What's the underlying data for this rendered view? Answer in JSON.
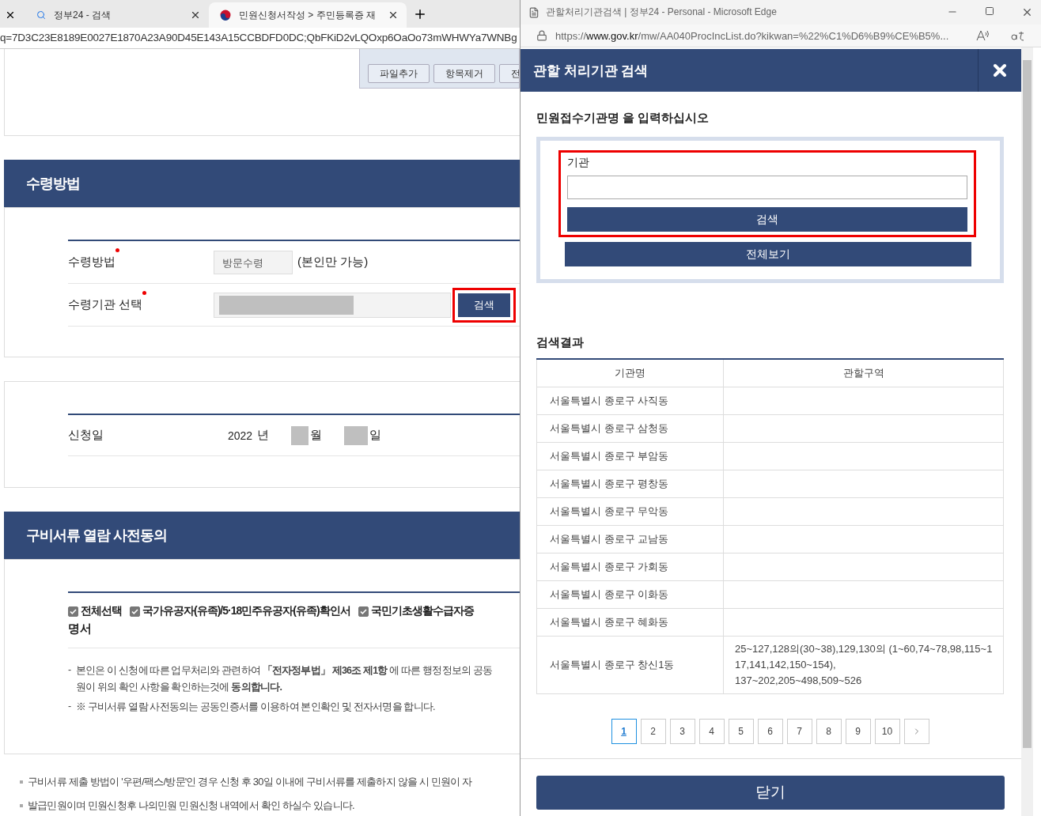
{
  "browser": {
    "tabs": [
      {
        "label": "정부24 - 검색",
        "selected": false
      },
      {
        "label": "민원신청서작성 > 주민등록증 재",
        "selected": true
      }
    ],
    "address": "q=7D3C23E8189E0027E1870A23A90D45E143A15CCBDFD0DC;QbFKiD2vLQOxp6OaOo73mWHWYa7WNBg"
  },
  "upload_buttons": [
    "파일추가",
    "항목제거",
    "전"
  ],
  "receipt": {
    "title": "수령방법",
    "rows": [
      {
        "kind": "method",
        "label": "수령방법",
        "required": true,
        "value": "방문수령",
        "note": "(본인만 가능)"
      },
      {
        "kind": "agency",
        "label": "수령기관 선택",
        "required": true,
        "button": "검색"
      }
    ]
  },
  "date": {
    "label": "신청일",
    "year": "2022",
    "year_unit": "년",
    "month_unit": "월",
    "day_unit": "일"
  },
  "consent": {
    "title": "구비서류 열람 사전동의",
    "checkboxes": [
      {
        "label": "전체선택",
        "checked": true
      },
      {
        "label": "국가유공자(유족)/**5·18**민주유공자(유족)확인서",
        "checked": true
      },
      {
        "label": "국민기초생활수급자증",
        "checked": true
      }
    ],
    "checkbox_wrap": "명서",
    "notes": [
      {
        "marker": "-",
        "lines": [
          "본인은 이 신청에 따른 업무처리와 관련하여 **「전자정부법」 제36조 제1항** 에 따른 행정정보의 공동",
          "원이 위의 확인 사항을 확인하는것에 **동의합니다.**"
        ]
      },
      {
        "marker": "-",
        "lines": [
          "※ 구비서류 열람 사전동의는 공동인증서를 이용하여 본인확인 및 전자서명을 합니다."
        ]
      }
    ]
  },
  "bullets": [
    "구비서류 제출 방법이 '우편/팩스/방문'인 경우 신청 후 30일 이내에 구비서류를 제출하지 않을 시 민원이 자",
    "발급민원이며 민원신청후 나의민원 민원신청 내역에서 확인 하실수 있습니다."
  ],
  "popup": {
    "window_title": "관할처리기관검색 | 정부24 - Personal - Microsoft Edge",
    "url_scheme": "https://",
    "url_host": "www.gov.kr",
    "url_rest": "/mw/AA040ProcIncList.do?kikwan=%22%C1%D6%B9%CE%B5%...",
    "title": "관할 처리기관 검색",
    "prompt": "민원접수기관명 을 입력하십시오",
    "field_label": "기관",
    "search_button": "검색",
    "all_button": "전체보기",
    "results_title": "검색결과",
    "columns": [
      "기관명",
      "관할구역"
    ],
    "rows": [
      {
        "name": "서울특별시 종로구 사직동"
      },
      {
        "name": "서울특별시 종로구 삼청동"
      },
      {
        "name": "서울특별시 종로구 부암동"
      },
      {
        "name": "서울특별시 종로구 평창동"
      },
      {
        "name": "서울특별시 종로구 무악동"
      },
      {
        "name": "서울특별시 종로구 교남동"
      },
      {
        "name": "서울특별시 종로구 가회동"
      },
      {
        "name": "서울특별시 종로구 이화동"
      },
      {
        "name": "서울특별시 종로구 혜화동"
      },
      {
        "name": "서울특별시 종로구 창신1동",
        "area": [
          "25~127,128의(30~38),129,130의 (1~60,74~78,98,115~117,141,142,150~154),",
          "137~202,205~498,509~526"
        ]
      }
    ],
    "pages": [
      {
        "label": "1",
        "selected": true
      },
      {
        "label": "2",
        "selected": false
      },
      {
        "label": "3",
        "selected": false
      },
      {
        "label": "4",
        "selected": false
      },
      {
        "label": "5",
        "selected": false
      },
      {
        "label": "6",
        "selected": false
      },
      {
        "label": "7",
        "selected": false
      },
      {
        "label": "8",
        "selected": false
      },
      {
        "label": "9",
        "selected": false
      },
      {
        "label": "10",
        "selected": false
      }
    ],
    "close_button": "닫기"
  }
}
